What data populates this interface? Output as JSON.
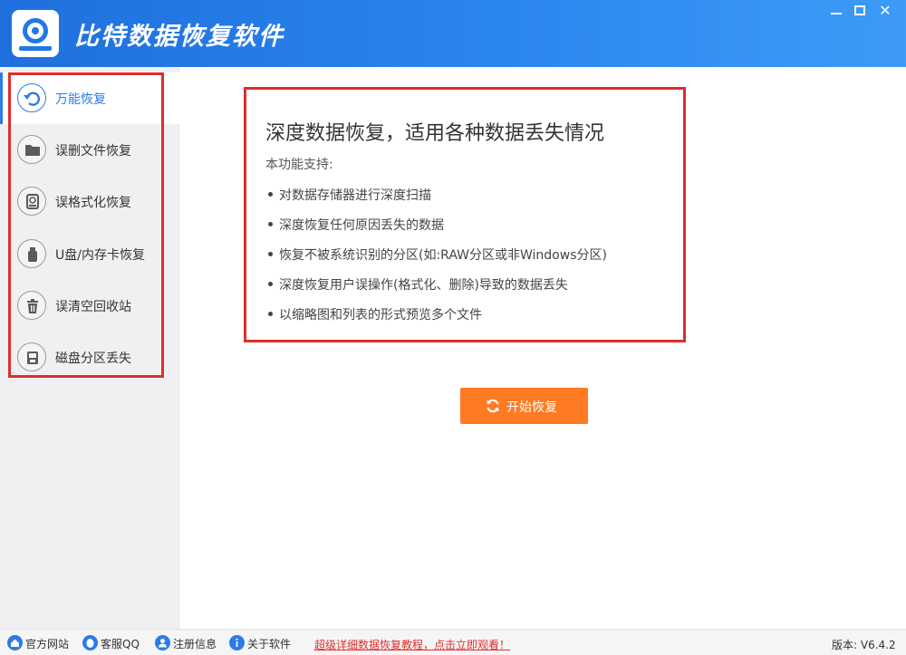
{
  "app": {
    "title": "比特数据恢复软件"
  },
  "window_controls": {
    "minimize_icon": "minimize-icon",
    "maximize_icon": "maximize-icon",
    "close_glyph": "✕"
  },
  "sidebar": {
    "items": [
      {
        "label": "万能恢复",
        "icon": "undo-icon",
        "active": true
      },
      {
        "label": "误删文件恢复",
        "icon": "folder-icon",
        "active": false
      },
      {
        "label": "误格式化恢复",
        "icon": "hard-drive-icon",
        "active": false
      },
      {
        "label": "U盘/内存卡恢复",
        "icon": "usb-icon",
        "active": false
      },
      {
        "label": "误清空回收站",
        "icon": "trash-icon",
        "active": false
      },
      {
        "label": "磁盘分区丢失",
        "icon": "disk-icon",
        "active": false
      }
    ]
  },
  "card": {
    "title": "深度数据恢复，适用各种数据丢失情况",
    "subtitle": "本功能支持:",
    "bullets": [
      "对数据存储器进行深度扫描",
      "深度恢复任何原因丢失的数据",
      "恢复不被系统识别的分区(如:RAW分区或非Windows分区)",
      "深度恢复用户误操作(格式化、删除)导致的数据丢失",
      "以缩略图和列表的形式预览多个文件"
    ]
  },
  "start_button": {
    "label": "开始恢复",
    "icon": "refresh-icon"
  },
  "footer": {
    "links": [
      {
        "label": "官方网站",
        "icon": "home-icon"
      },
      {
        "label": "客服QQ",
        "icon": "qq-icon"
      },
      {
        "label": "注册信息",
        "icon": "user-icon"
      },
      {
        "label": "关于软件",
        "icon": "info-icon"
      }
    ],
    "promo": "超级详细数据恢复教程，点击立即观看！",
    "version": "版本: V6.4.2"
  },
  "colors": {
    "accent": "#2b7ce8",
    "titlebar": "#1f6fdd",
    "highlight": "#e12c2c",
    "start_button": "#ff7a22"
  }
}
